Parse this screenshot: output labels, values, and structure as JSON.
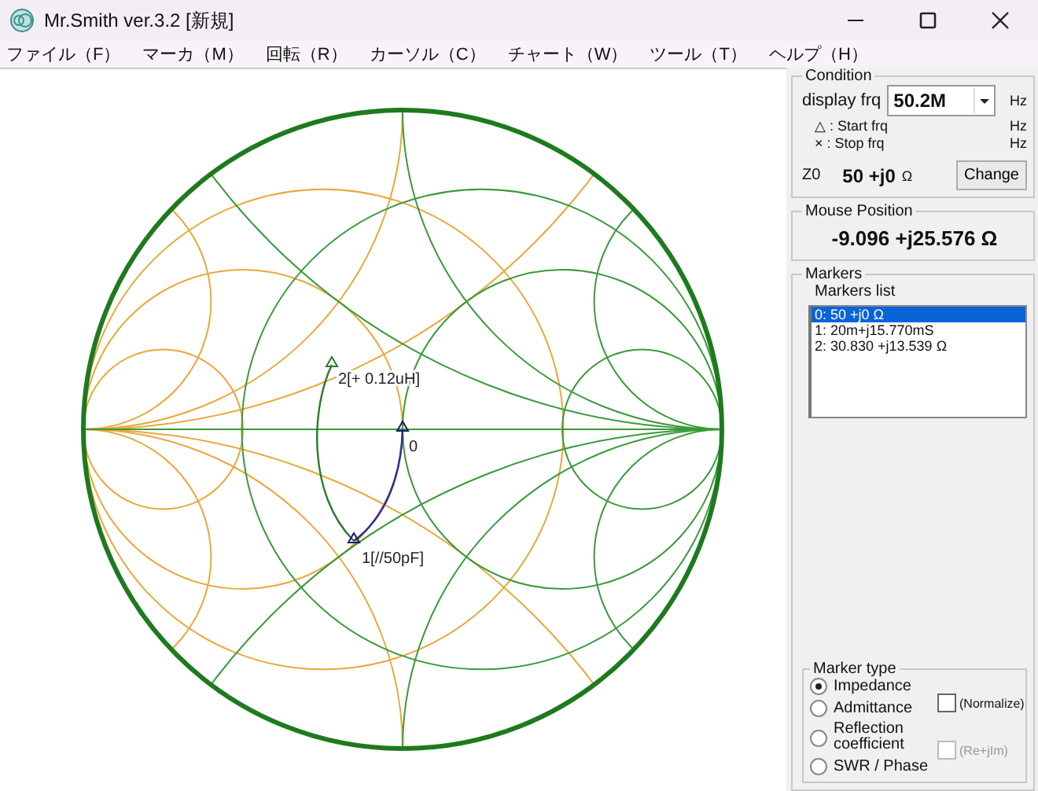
{
  "window": {
    "title": "Mr.Smith ver.3.2 [新規]"
  },
  "menu": [
    "ファイル（F）",
    "マーカ（M）",
    "回転（R）",
    "カーソル（C）",
    "チャート（W）",
    "ツール（T）",
    "ヘルプ（H）"
  ],
  "chart": {
    "markers": [
      {
        "kind": "inductor",
        "label": "2[+ 0.12uH]"
      },
      {
        "kind": "origin",
        "label": "0"
      },
      {
        "kind": "capacitor",
        "label": "1[//50pF]"
      }
    ]
  },
  "condition": {
    "title": "Condition",
    "display_label": "display frq",
    "display_value": "50.2M",
    "display_unit": "Hz",
    "start_label": "△ : Start frq",
    "start_unit": "Hz",
    "stop_label": "× : Stop frq",
    "stop_unit": "Hz",
    "z0_label": "Z0",
    "z0_value": "50 +j0",
    "z0_unit": "Ω",
    "change_button": "Change"
  },
  "mouse_position": {
    "title": "Mouse Position",
    "value": "-9.096  +j25.576 Ω"
  },
  "markers": {
    "title": "Markers",
    "list_title": "Markers list",
    "items": [
      {
        "text": "0: 50 +j0 Ω",
        "selected": true
      },
      {
        "text": "1: 20m+j15.770mS",
        "selected": false
      },
      {
        "text": "2: 30.830 +j13.539 Ω",
        "selected": false
      }
    ]
  },
  "marker_type": {
    "title": "Marker type",
    "options": [
      {
        "label": "Impedance",
        "selected": true
      },
      {
        "label": "Admittance",
        "selected": false
      },
      {
        "label": "Reflection coefficient",
        "selected": false
      },
      {
        "label": "SWR / Phase",
        "selected": false
      }
    ],
    "checkboxes": [
      {
        "label": "(Normalize)",
        "checked": false,
        "disabled": false
      },
      {
        "label": "(Re+jIm)",
        "checked": false,
        "disabled": true
      }
    ]
  }
}
